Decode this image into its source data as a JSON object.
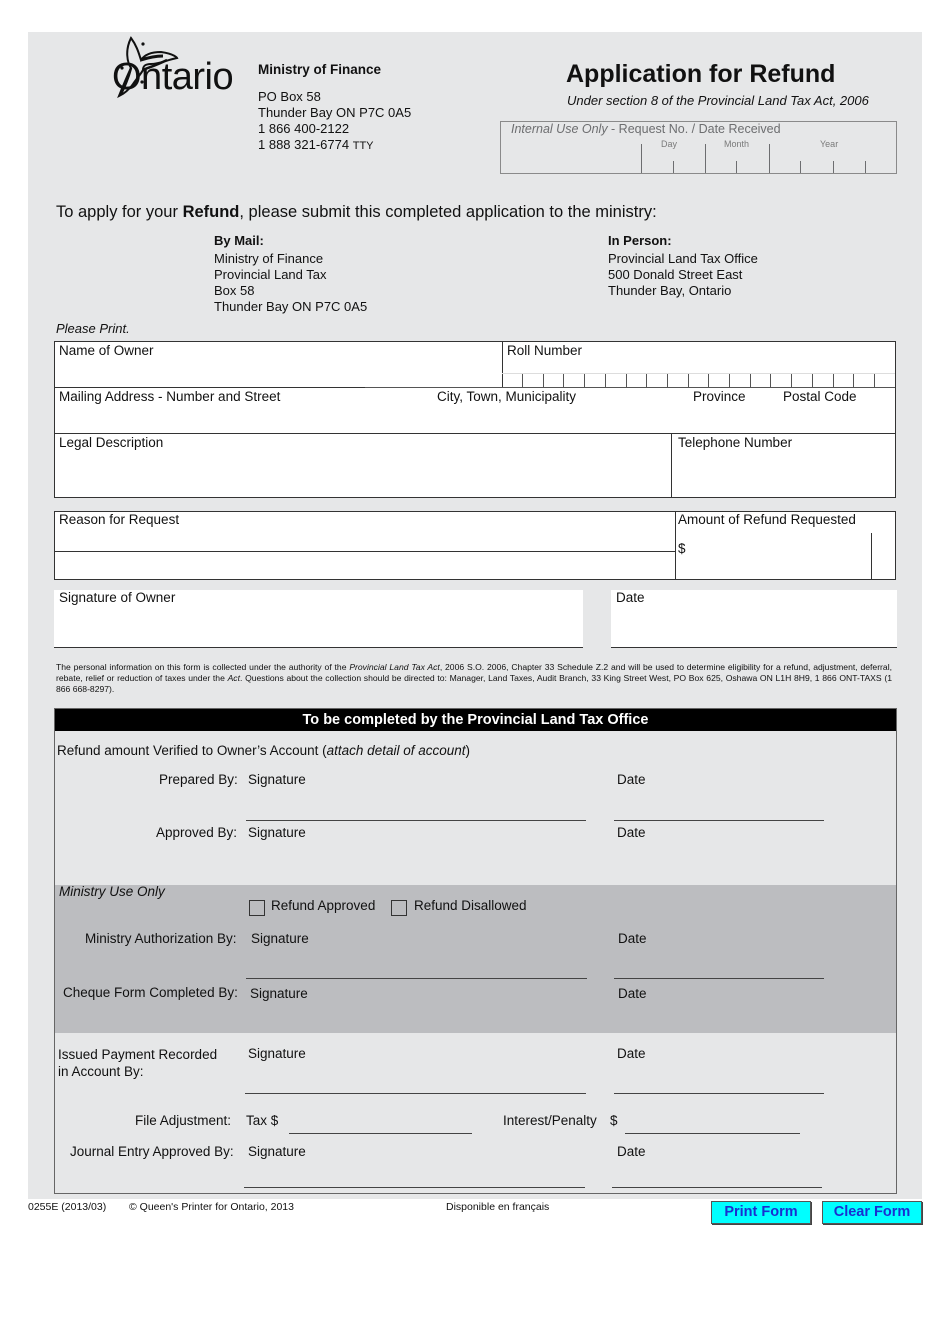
{
  "header": {
    "logo_word": "Ontario",
    "ministry_name": "Ministry of Finance",
    "ministry_address": [
      "PO Box 58",
      "Thunder Bay ON P7C 0A5",
      "1 866 400-2122"
    ],
    "tty_number": "1 888 321-6774",
    "tty_label": "TTY",
    "title": "Application for Refund",
    "subtitle": "Under section 8 of the Provincial Land Tax Act, 2006",
    "internal_use": {
      "italic_label": "Internal Use Only",
      "rest_label": " - Request No. / Date Received",
      "day_label": "Day",
      "month_label": "Month",
      "year_label": "Year"
    }
  },
  "intro": {
    "before": "To apply for your ",
    "bold": "Refund",
    "after": ", please submit this completed application to the ministry:"
  },
  "by_mail": {
    "heading": "By Mail:",
    "lines": [
      "Ministry of Finance",
      "Provincial Land Tax",
      "Box 58",
      "Thunder Bay ON P7C 0A5"
    ]
  },
  "in_person": {
    "heading": "In Person:",
    "lines": [
      "Provincial Land Tax Office",
      "500 Donald Street East",
      "Thunder Bay, Ontario"
    ]
  },
  "please_print": "Please Print.",
  "owner_section": {
    "name_of_owner": "Name of Owner",
    "roll_number": "Roll Number",
    "mailing_address": "Mailing Address - Number and Street",
    "city": "City, Town, Municipality",
    "province": "Province",
    "postal_code": "Postal Code",
    "legal_description": "Legal Description",
    "telephone": "Telephone Number"
  },
  "reason_section": {
    "reason": "Reason for Request",
    "amount": "Amount of Refund Requested",
    "dollar": "$"
  },
  "signature_section": {
    "signature_of_owner": "Signature of Owner",
    "date": "Date"
  },
  "notice": {
    "p1": "The personal information on this form is collected under the authority of the ",
    "act1": "Provincial Land Tax Act",
    "p2": ", 2006 S.O. 2006, Chapter 33 Schedule Z.2 and will be used to determine eligibility for a refund, adjustment, deferral, rebate, relief or reduction of taxes under the ",
    "act2": "Act",
    "p3": ". Questions about the collection should be directed to: Manager, Land Taxes, Audit Branch, 33 King Street West, PO Box 625, Oshawa ON L1H 8H9, 1 866 ONT-TAXS (1 866 668-8297)."
  },
  "office": {
    "heading": "To be completed by the Provincial Land Tax Office",
    "verified_text": "Refund amount Verified to Owner’s Account (",
    "verified_italic": "attach detail of account",
    "verified_close": ")",
    "prepared_by": "Prepared By:",
    "approved_by": "Approved By:",
    "signature": "Signature",
    "date": "Date",
    "ministry_use_only": "Ministry Use Only",
    "refund_approved": "Refund Approved",
    "refund_disallowed": "Refund Disallowed",
    "refund_approved_checked": false,
    "refund_disallowed_checked": false,
    "ministry_authorization_by": "Ministry Authorization By:",
    "cheque_form_completed_by": "Cheque Form Completed By:",
    "issued_payment_line1": "Issued Payment Recorded",
    "issued_payment_line2": "in Account By:",
    "file_adjustment": "File Adjustment:",
    "tax_dollar": "Tax $",
    "interest_penalty": "Interest/Penalty",
    "dollar": "$",
    "journal_entry_approved_by": "Journal Entry Approved By:"
  },
  "footer": {
    "form_number": "0255E (2013/03)",
    "copyright": "© Queen's Printer for Ontario, 2013",
    "french": "Disponible en français",
    "print_button": "Print Form",
    "clear_button": "Clear Form"
  },
  "colors": {
    "page_background": "#e6e7e8",
    "ministry_band": "#bcbdc0",
    "button_fill": "#00ffff",
    "button_text": "#1a2fd1"
  }
}
